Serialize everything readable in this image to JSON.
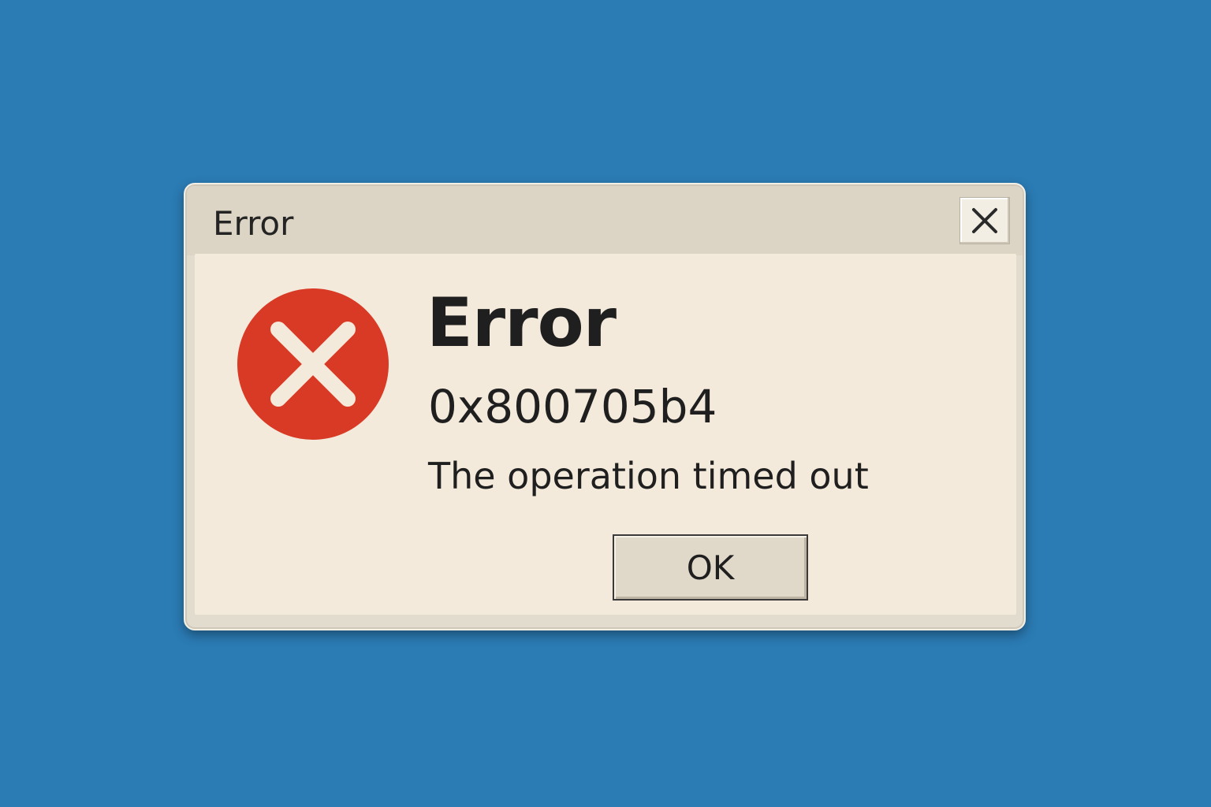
{
  "window": {
    "title": "Error"
  },
  "titlebar": {
    "close_icon": "close-icon"
  },
  "content": {
    "icon": "error-x-circle-icon",
    "heading": "Error",
    "error_code": "0x800705b4",
    "message": "The operation timed out"
  },
  "buttons": {
    "ok_label": "OK"
  },
  "colors": {
    "desktop": "#2b7bb4",
    "dialog_background": "#f4eadb",
    "titlebar": "#dcd4c4",
    "error_icon": "#d93a26",
    "text": "#1f1f1f"
  }
}
